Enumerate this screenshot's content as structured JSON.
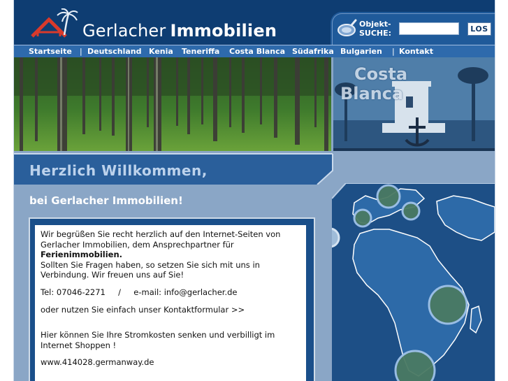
{
  "brand": {
    "name_light": "Gerlacher",
    "name_bold": "Immobilien"
  },
  "search": {
    "label_line1": "Objekt-",
    "label_line2": "SUCHE:",
    "value": "",
    "button_label": "LOS"
  },
  "nav": {
    "items": [
      {
        "label": "Startseite"
      },
      {
        "label": "Deutschland"
      },
      {
        "label": "Kenia"
      },
      {
        "label": "Teneriffa"
      },
      {
        "label": "Costa Blanca"
      },
      {
        "label": "Südafrika"
      },
      {
        "label": "Bulgarien"
      },
      {
        "label": "Kontakt"
      }
    ],
    "separator": "|"
  },
  "banner": {
    "region_title_line1": "Costa",
    "region_title_line2": "Blanca"
  },
  "welcome": {
    "title": "Herzlich Willkommen,",
    "subheading": "bei Gerlacher Immobilien!"
  },
  "content": {
    "intro_part1": "Wir begrüßen Sie recht herzlich auf den Internet-Seiten von Gerlacher Immobilien, dem Ansprechpartner für",
    "intro_bold": "Ferienimmobilien.",
    "intro_part2": "Sollten Sie Fragen haben, so setzen Sie sich mit uns in Verbindung. Wir freuen uns auf Sie!",
    "contact_line": "Tel: 07046-2271     /     e-mail: info@gerlacher.de",
    "contact_form_line": "oder nutzen Sie einfach unser Kontaktformular >>",
    "energy_text": "Hier können Sie Ihre Stromkosten senken und verbilligt im Internet Shoppen !",
    "website": "www.414028.germanway.de"
  },
  "colors": {
    "header_bg": "#0e3d72",
    "nav_bg": "#2e6aac",
    "page_bg": "#8aa6c6",
    "accent_blue": "#1a4f8a"
  }
}
